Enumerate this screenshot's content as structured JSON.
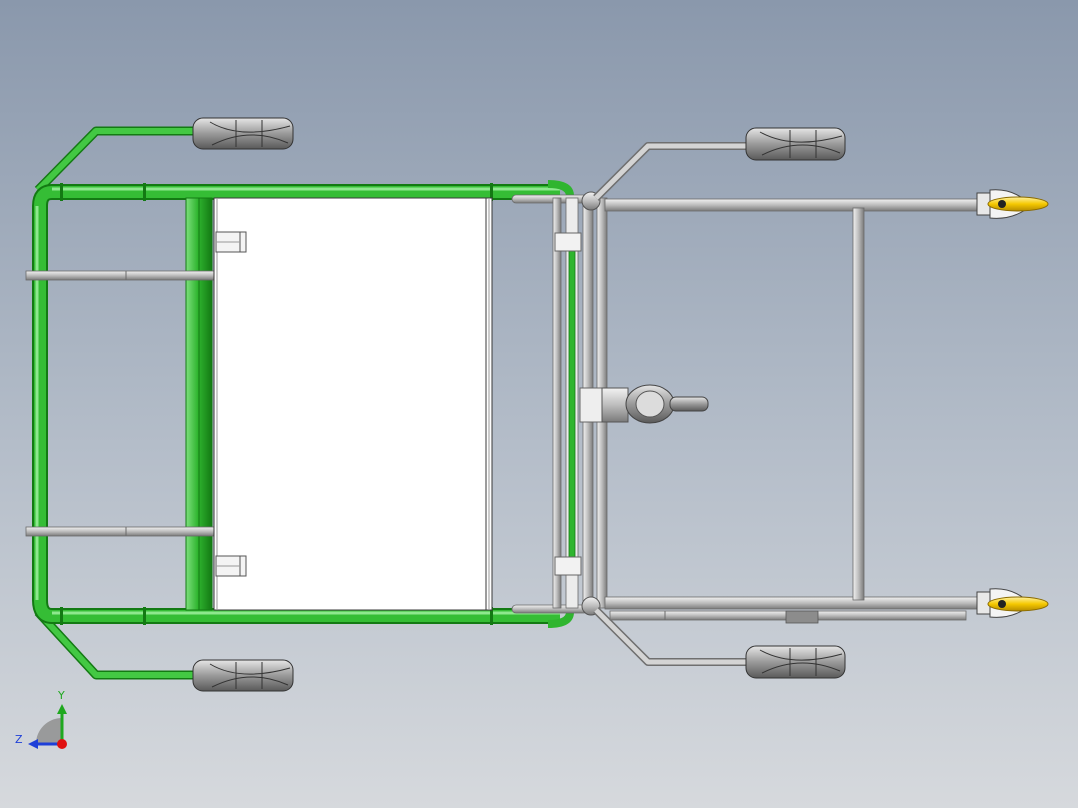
{
  "scene": {
    "background_top": "#8a98ac",
    "background_bottom": "#d6d9dd",
    "green_tube_color": "#2fb52f",
    "grey_tube_color": "#c8c8c8",
    "panel_color": "#ffffff",
    "caster_accent_color": "#f5c800"
  },
  "triad": {
    "y_label": "Y",
    "z_label": "Z",
    "y_color": "#1fa81f",
    "z_color": "#1e3fd8",
    "origin_color": "#e01010"
  }
}
